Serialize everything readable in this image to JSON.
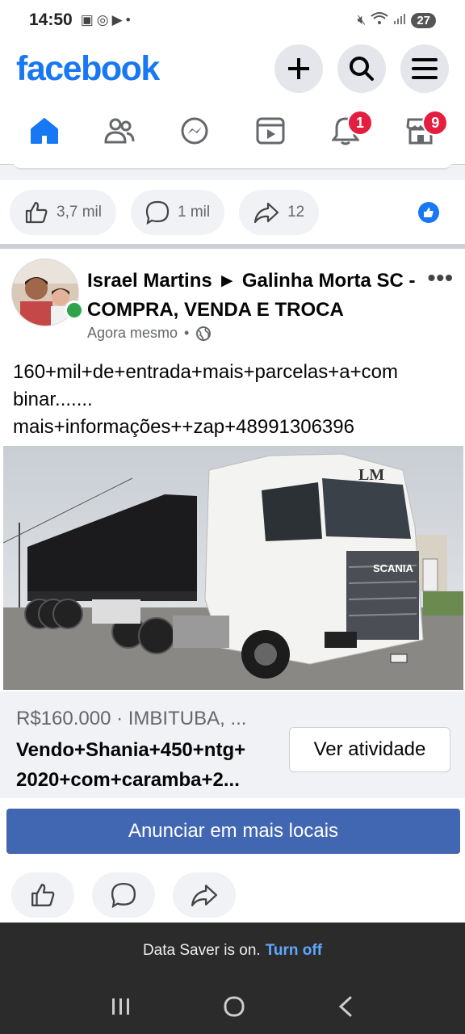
{
  "status_bar": {
    "time": "14:50",
    "battery": "27"
  },
  "header": {
    "logo": "facebook"
  },
  "nav": {
    "notifications_badge": "1",
    "marketplace_badge": "9"
  },
  "prev_post": {
    "likes": "3,7 mil",
    "comments": "1 mil",
    "shares": "12"
  },
  "post": {
    "author": "Israel Martins ► Galinha Morta SC - COMPRA, VENDA E TROCA",
    "time": "Agora mesmo",
    "text_line1": "160+mil+de+entrada+mais+parcelas+a+com",
    "text_line2": "binar.......",
    "text_line3": "mais+informações++zap+48991306396",
    "truck_brand": "SCANIA",
    "truck_logo": "LM"
  },
  "listing": {
    "price_location": "R$160.000 · IMBITUBA, ...",
    "title": "Vendo+Shania+450+ntg+ 2020+com+caramba+2...",
    "ver_atividade": "Ver atividade",
    "cta": "Anunciar em mais locais"
  },
  "data_saver": {
    "text": "Data Saver is on.",
    "link": "Turn off"
  },
  "colors": {
    "brand": "#1877f2",
    "cta": "#4267b2",
    "badge": "#e41e3f",
    "online": "#31a24c"
  }
}
